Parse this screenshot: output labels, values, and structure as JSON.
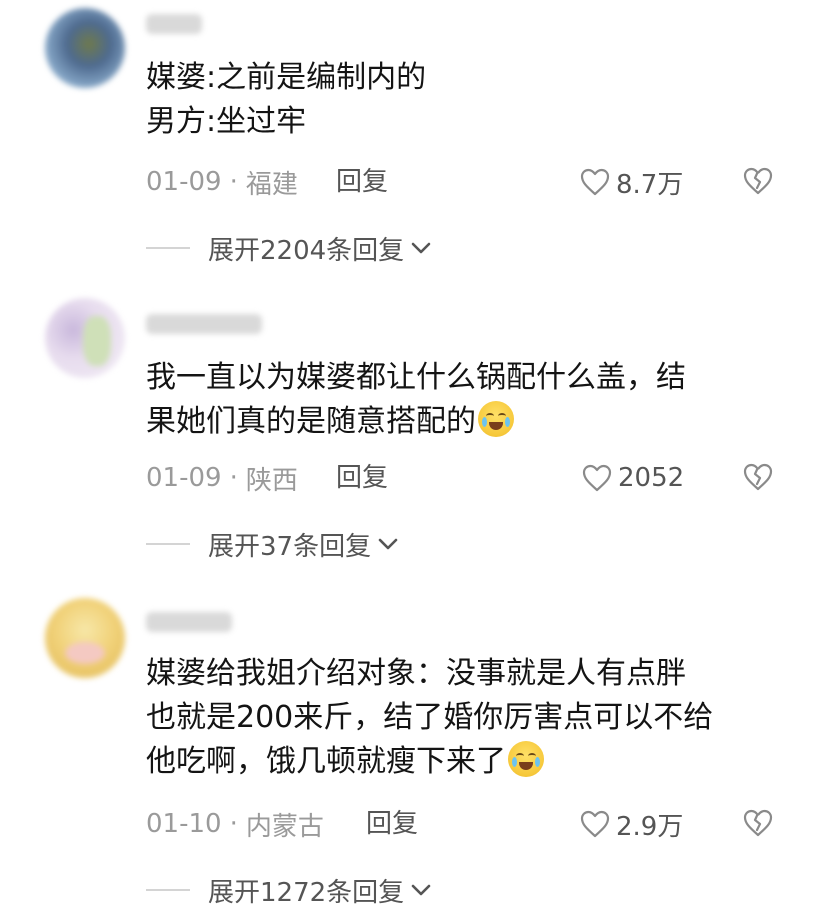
{
  "comments": [
    {
      "lines": [
        "媒婆:之前是编制内的",
        "男方:坐过牢"
      ],
      "emoji": "",
      "date": "01-09",
      "location": "福建",
      "reply_label": "回复",
      "likes": "8.7万",
      "expand_label": "展开2204条回复"
    },
    {
      "lines": [
        "我一直以为媒婆都让什么锅配什么盖，结",
        "果她们真的是随意搭配的"
      ],
      "emoji": "loudly-crying-emoji",
      "date": "01-09",
      "location": "陕西",
      "reply_label": "回复",
      "likes": "2052",
      "expand_label": "展开37条回复"
    },
    {
      "lines": [
        "媒婆给我姐介绍对象：没事就是人有点胖",
        "也就是200来斤，结了婚你厉害点可以不给",
        "他吃啊，饿几顿就瘦下来了"
      ],
      "emoji": "tears-of-joy-emoji",
      "date": "01-10",
      "location": "内蒙古",
      "reply_label": "回复",
      "likes": "2.9万",
      "expand_label": "展开1272条回复"
    }
  ],
  "separator": "·",
  "icons": {
    "like": "heart-outline-icon",
    "dislike": "broken-heart-icon",
    "expand": "chevron-down-icon"
  },
  "colors": {
    "text": "#141414",
    "meta": "#9a9a9a",
    "action": "#555555"
  }
}
